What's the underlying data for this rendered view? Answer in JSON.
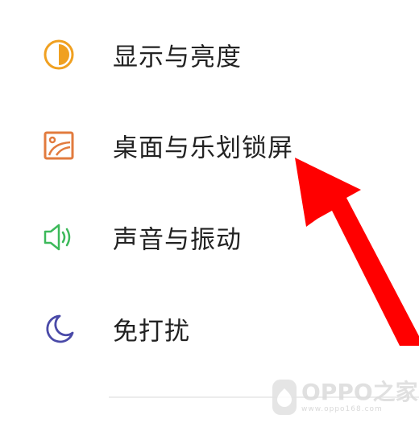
{
  "settings": {
    "items": [
      {
        "label": "显示与亮度",
        "icon": "display-brightness-icon"
      },
      {
        "label": "桌面与乐划锁屏",
        "icon": "wallpaper-icon"
      },
      {
        "label": "声音与振动",
        "icon": "speaker-icon"
      },
      {
        "label": "免打扰",
        "icon": "moon-icon"
      }
    ]
  },
  "watermark": {
    "brand": "OPPO之家",
    "url": "www.oppo168.com"
  },
  "colors": {
    "display_icon": "#f0a020",
    "wallpaper_icon": "#e27b3e",
    "sound_icon": "#3cb95a",
    "dnd_icon": "#4a4aa8",
    "arrow": "#ff0000",
    "text": "#222222"
  }
}
